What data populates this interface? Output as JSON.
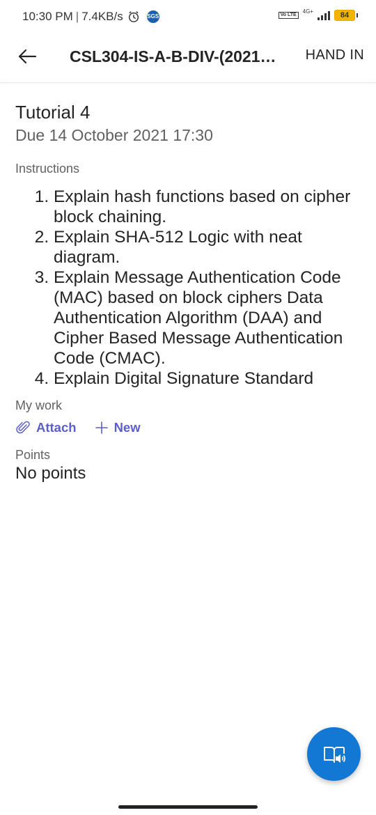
{
  "status_bar": {
    "time": "10:30 PM",
    "separator": "|",
    "net_speed": "7.4KB/s",
    "badge": "SGS",
    "volte": "Vo LTE",
    "network": "4G+",
    "battery": "84"
  },
  "header": {
    "title": "CSL304-IS-A-B-DIV-(2021…",
    "hand_in_label": "HAND IN"
  },
  "assignment": {
    "title": "Tutorial 4",
    "due": "Due 14 October 2021 17:30"
  },
  "instructions": {
    "label": "Instructions",
    "items": [
      "Explain hash functions based on cipher block chaining.",
      "Explain SHA-512 Logic with neat diagram.",
      "Explain Message Authentication Code (MAC) based on block ciphers Data Authentication Algorithm (DAA) and Cipher Based Message Authentication Code (CMAC).",
      "Explain Digital Signature Standard"
    ]
  },
  "my_work": {
    "label": "My work",
    "attach_label": "Attach",
    "new_label": "New"
  },
  "points": {
    "label": "Points",
    "value": "No points"
  },
  "fab": {
    "icon": "immersive-reader-icon"
  },
  "colors": {
    "accent": "#5b5fc7",
    "fab": "#1278d4",
    "battery": "#f3b400"
  }
}
